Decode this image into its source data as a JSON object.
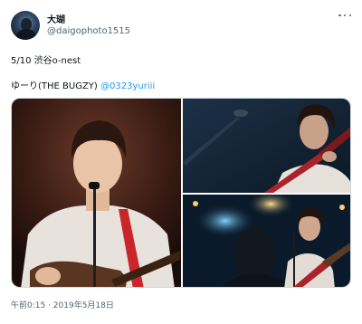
{
  "author": {
    "name": "大瑚",
    "handle": "@daigophoto1515"
  },
  "tweet": {
    "line1": "5/10 渋谷o-nest",
    "line2_prefix": "ゆーり(THE BUGZY) ",
    "mention": "@0323yuriii",
    "timestamp": "午前0:15 · 2019年5月18日"
  },
  "icons": {
    "more": "more-options-icon"
  },
  "colors": {
    "text": "#0f1419",
    "secondary": "#536471",
    "link": "#1d9bf0"
  }
}
